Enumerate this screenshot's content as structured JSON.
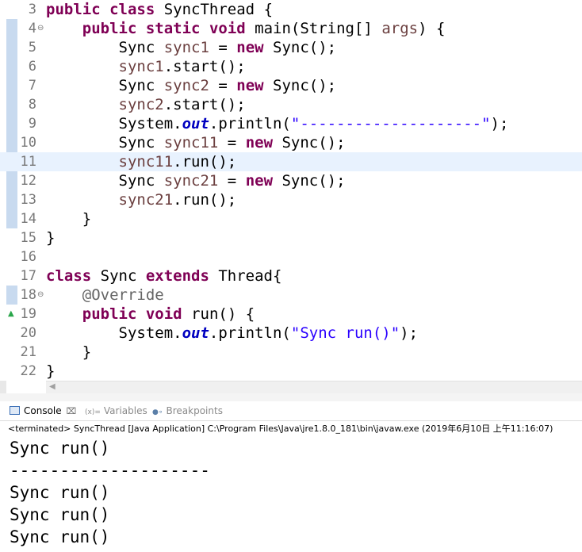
{
  "editor": {
    "lines": [
      {
        "num": "3",
        "tokens": [
          [
            "k",
            "public"
          ],
          [
            "p",
            " "
          ],
          [
            "k",
            "class"
          ],
          [
            "p",
            " SyncThread {"
          ]
        ]
      },
      {
        "num": "4",
        "fold": "⊖",
        "tokens": [
          [
            "p",
            "    "
          ],
          [
            "k",
            "public"
          ],
          [
            "p",
            " "
          ],
          [
            "k",
            "static"
          ],
          [
            "p",
            " "
          ],
          [
            "k",
            "void"
          ],
          [
            "p",
            " main(String[] "
          ],
          [
            "v",
            "args"
          ],
          [
            "p",
            ") {"
          ]
        ]
      },
      {
        "num": "5",
        "tokens": [
          [
            "p",
            "        Sync "
          ],
          [
            "v",
            "sync1"
          ],
          [
            "p",
            " = "
          ],
          [
            "k",
            "new"
          ],
          [
            "p",
            " Sync();"
          ]
        ]
      },
      {
        "num": "6",
        "tokens": [
          [
            "p",
            "        "
          ],
          [
            "v",
            "sync1"
          ],
          [
            "p",
            ".start();"
          ]
        ]
      },
      {
        "num": "7",
        "tokens": [
          [
            "p",
            "        Sync "
          ],
          [
            "v",
            "sync2"
          ],
          [
            "p",
            " = "
          ],
          [
            "k",
            "new"
          ],
          [
            "p",
            " Sync();"
          ]
        ]
      },
      {
        "num": "8",
        "tokens": [
          [
            "p",
            "        "
          ],
          [
            "v",
            "sync2"
          ],
          [
            "p",
            ".start();"
          ]
        ]
      },
      {
        "num": "9",
        "tokens": [
          [
            "p",
            "        System."
          ],
          [
            "f",
            "out"
          ],
          [
            "p",
            ".println("
          ],
          [
            "s",
            "\"--------------------\""
          ],
          [
            "p",
            ");"
          ]
        ]
      },
      {
        "num": "10",
        "tokens": [
          [
            "p",
            "        Sync "
          ],
          [
            "v",
            "sync11"
          ],
          [
            "p",
            " = "
          ],
          [
            "k",
            "new"
          ],
          [
            "p",
            " Sync();"
          ]
        ]
      },
      {
        "num": "11",
        "current": true,
        "tokens": [
          [
            "p",
            "        "
          ],
          [
            "v",
            "sync11"
          ],
          [
            "p",
            ".run();"
          ]
        ]
      },
      {
        "num": "12",
        "tokens": [
          [
            "p",
            "        Sync "
          ],
          [
            "v",
            "sync21"
          ],
          [
            "p",
            " = "
          ],
          [
            "k",
            "new"
          ],
          [
            "p",
            " Sync();"
          ]
        ]
      },
      {
        "num": "13",
        "tokens": [
          [
            "p",
            "        "
          ],
          [
            "v",
            "sync21"
          ],
          [
            "p",
            ".run();"
          ]
        ]
      },
      {
        "num": "14",
        "tokens": [
          [
            "p",
            "    }"
          ]
        ]
      },
      {
        "num": "15",
        "tokens": [
          [
            "p",
            "}"
          ]
        ]
      },
      {
        "num": "16",
        "tokens": []
      },
      {
        "num": "17",
        "tokens": [
          [
            "k",
            "class"
          ],
          [
            "p",
            " Sync "
          ],
          [
            "k",
            "extends"
          ],
          [
            "p",
            " Thread{"
          ]
        ]
      },
      {
        "num": "18",
        "fold": "⊖",
        "tokens": [
          [
            "p",
            "    "
          ],
          [
            "a",
            "@Override"
          ]
        ]
      },
      {
        "num": "19",
        "override": "▲",
        "tokens": [
          [
            "p",
            "    "
          ],
          [
            "k",
            "public"
          ],
          [
            "p",
            " "
          ],
          [
            "k",
            "void"
          ],
          [
            "p",
            " run() {"
          ]
        ]
      },
      {
        "num": "20",
        "tokens": [
          [
            "p",
            "        System."
          ],
          [
            "f",
            "out"
          ],
          [
            "p",
            ".println("
          ],
          [
            "s",
            "\"Sync run()\""
          ],
          [
            "p",
            ");"
          ]
        ]
      },
      {
        "num": "21",
        "tokens": [
          [
            "p",
            "    }"
          ]
        ]
      },
      {
        "num": "22",
        "tokens": [
          [
            "p",
            "}"
          ]
        ]
      }
    ]
  },
  "tabs": {
    "console_label": "Console",
    "console_close": "⌧",
    "variables_icon": "(x)=",
    "variables_label": "Variables",
    "breakpoints_icon": "●∘",
    "breakpoints_label": "Breakpoints"
  },
  "console": {
    "status": "<terminated> SyncThread [Java Application] C:\\Program Files\\Java\\jre1.8.0_181\\bin\\javaw.exe (2019年6月10日 上午11:16:07)",
    "output": [
      "Sync run()",
      "--------------------",
      "Sync run()",
      "Sync run()",
      "Sync run()"
    ]
  },
  "colors": {
    "keyword": "#7f0055",
    "local_var": "#6a3e3e",
    "static_field": "#0000c0",
    "string": "#2a00ff",
    "annotation": "#646464",
    "current_line": "#e8f2fe"
  }
}
